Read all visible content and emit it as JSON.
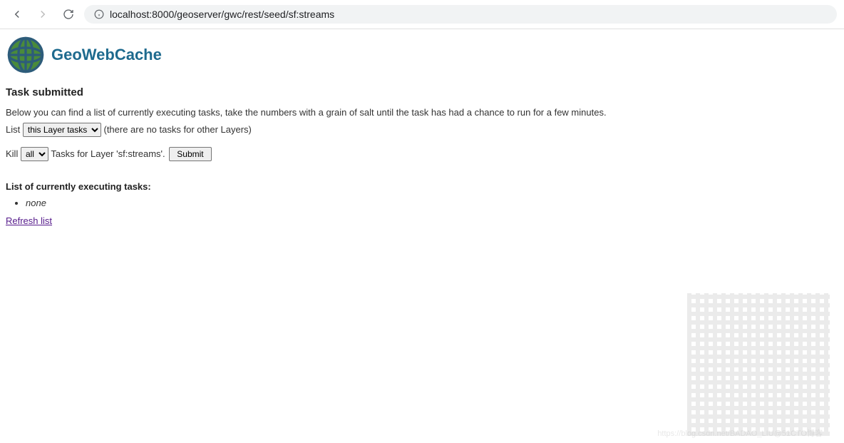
{
  "browser": {
    "url_display": "localhost:8000/geoserver/gwc/rest/seed/sf:streams"
  },
  "brand": {
    "name": "GeoWebCache"
  },
  "page": {
    "title": "Task submitted",
    "intro": "Below you can find a list of currently executing tasks, take the numbers with a grain of salt until the task has had a chance to run for a few minutes.",
    "list_prefix": "List",
    "list_select": {
      "selected": "this Layer tasks",
      "options": [
        "this Layer tasks"
      ]
    },
    "list_suffix": "(there are no tasks for other Layers)",
    "kill_prefix": "Kill",
    "kill_select": {
      "selected": "all",
      "options": [
        "all"
      ]
    },
    "kill_suffix": "Tasks for Layer 'sf:streams'.",
    "submit_label": "Submit",
    "section_title": "List of currently executing tasks:",
    "tasks": [
      "none"
    ],
    "refresh_label": "Refresh list"
  },
  "watermark": {
    "text": "https://blog.csdn.net/BADAO_LIU@51CTO博客"
  }
}
